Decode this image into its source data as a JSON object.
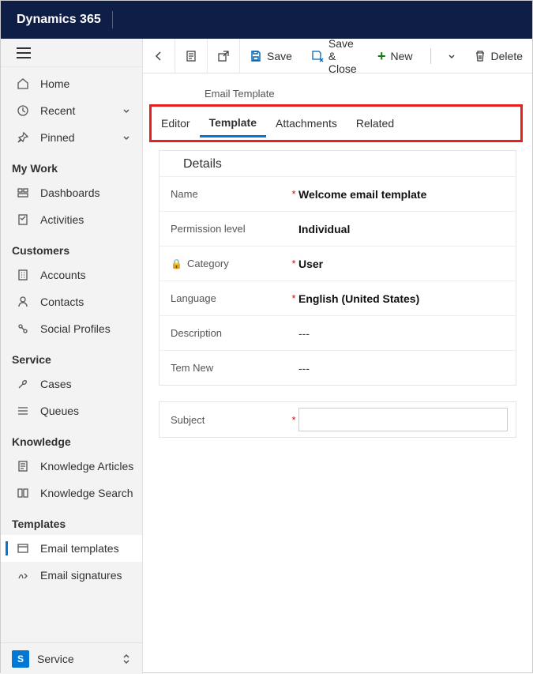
{
  "app_title": "Dynamics 365",
  "sidebar": {
    "home": "Home",
    "recent": "Recent",
    "pinned": "Pinned",
    "sections": {
      "mywork": {
        "title": "My Work",
        "items": [
          "Dashboards",
          "Activities"
        ]
      },
      "customers": {
        "title": "Customers",
        "items": [
          "Accounts",
          "Contacts",
          "Social Profiles"
        ]
      },
      "service": {
        "title": "Service",
        "items": [
          "Cases",
          "Queues"
        ]
      },
      "knowledge": {
        "title": "Knowledge",
        "items": [
          "Knowledge Articles",
          "Knowledge Search"
        ]
      },
      "templates": {
        "title": "Templates",
        "items": [
          "Email templates",
          "Email signatures"
        ]
      }
    },
    "area_switch": {
      "initial": "S",
      "label": "Service"
    }
  },
  "commands": {
    "save": "Save",
    "save_close": "Save & Close",
    "new": "New",
    "delete": "Delete"
  },
  "record": {
    "entity_label": "Email Template",
    "tabs": [
      "Editor",
      "Template",
      "Attachments",
      "Related"
    ],
    "active_tab": "Template",
    "section_title": "Details",
    "fields": {
      "name": {
        "label": "Name",
        "required": true,
        "value": "Welcome email template"
      },
      "permission": {
        "label": "Permission level",
        "required": false,
        "value": "Individual"
      },
      "category": {
        "label": "Category",
        "required": true,
        "value": "User",
        "locked": true
      },
      "language": {
        "label": "Language",
        "required": true,
        "value": "English (United States)"
      },
      "description": {
        "label": "Description",
        "required": false,
        "value": "---"
      },
      "temnew": {
        "label": "Tem New",
        "required": false,
        "value": "---"
      }
    },
    "subject": {
      "label": "Subject",
      "required": true,
      "value": ""
    }
  }
}
